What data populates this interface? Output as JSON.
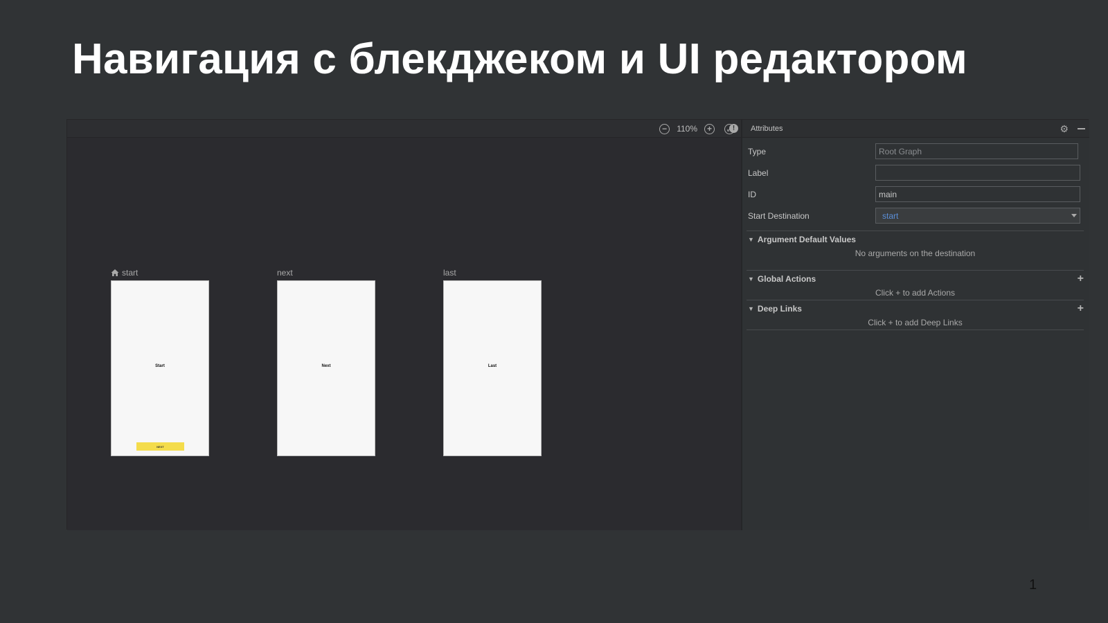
{
  "slide": {
    "title": "Навигация с блекджеком и UI редактором",
    "page_number": "1"
  },
  "toolbar": {
    "zoom_level": "110%",
    "zoom_out_icon": "minus-circle-icon",
    "zoom_in_icon": "plus-circle-icon",
    "fit_icon": "fit-screen-icon",
    "warning_icon": "exclamation-circle-icon"
  },
  "destinations": [
    {
      "label": "start",
      "is_start": true,
      "screen_text": "Start",
      "button": "NEXT"
    },
    {
      "label": "next",
      "is_start": false,
      "screen_text": "Next"
    },
    {
      "label": "last",
      "is_start": false,
      "screen_text": "Last"
    }
  ],
  "attributes": {
    "title": "Attributes",
    "fields": [
      {
        "label": "Type",
        "value": "Root Graph"
      },
      {
        "label": "Label",
        "value": ""
      },
      {
        "label": "ID",
        "value": "main"
      },
      {
        "label": "Start Destination",
        "value": "start"
      }
    ],
    "sections": [
      {
        "title": "Argument Default Values",
        "empty_text": "No arguments on the destination",
        "has_add": false
      },
      {
        "title": "Global Actions",
        "empty_text": "Click + to add Actions",
        "has_add": true
      },
      {
        "title": "Deep Links",
        "empty_text": "Click + to add Deep Links",
        "has_add": true
      }
    ]
  },
  "colors": {
    "accent_link": "#5b8fd8",
    "button_yellow": "#f4dc4c"
  }
}
